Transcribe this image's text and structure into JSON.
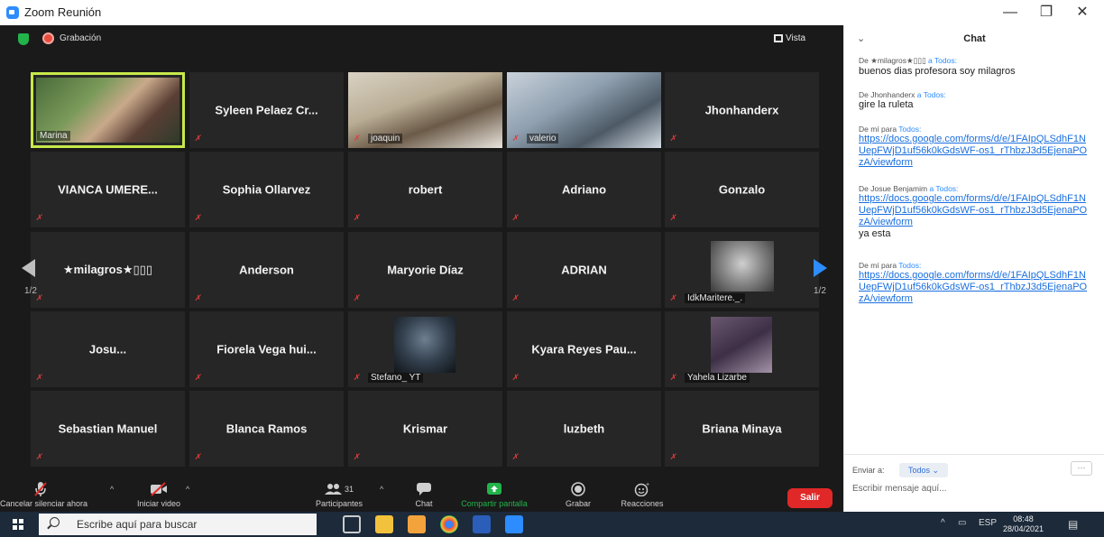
{
  "window": {
    "title": "Zoom Reunión",
    "minimize": "—",
    "restore": "❐",
    "close": "✕"
  },
  "topbar": {
    "recording_label": "Grabación",
    "view_label": "Vista"
  },
  "page_indicator": {
    "left": "1/2",
    "right": "1/2"
  },
  "participants": [
    {
      "name": "Marina",
      "video": true,
      "active": true,
      "muted": false
    },
    {
      "name": "Syleen Pelaez Cr...",
      "video": false,
      "muted": true
    },
    {
      "name": "joaquin",
      "video": true,
      "muted": true
    },
    {
      "name": "valerio",
      "video": true,
      "muted": true
    },
    {
      "name": "Jhonhanderx",
      "video": false,
      "muted": true
    },
    {
      "name": "VIANCA UMERE...",
      "video": false,
      "muted": true
    },
    {
      "name": "Sophia Ollarvez",
      "video": false,
      "muted": true
    },
    {
      "name": "robert",
      "video": false,
      "muted": true
    },
    {
      "name": "Adriano",
      "video": false,
      "muted": true
    },
    {
      "name": "Gonzalo",
      "video": false,
      "muted": true
    },
    {
      "name": "★milagros★▯▯▯",
      "video": false,
      "muted": true
    },
    {
      "name": "Anderson",
      "video": false,
      "muted": true
    },
    {
      "name": "Maryorie Díaz",
      "video": false,
      "muted": true
    },
    {
      "name": "ADRIAN",
      "video": false,
      "muted": true
    },
    {
      "name": "IdkMaritere._.",
      "video": true,
      "muted": true
    },
    {
      "name": "Josu...",
      "video": false,
      "muted": true
    },
    {
      "name": "Fiorela Vega hui...",
      "video": false,
      "muted": true
    },
    {
      "name": "Stefano_ YT",
      "video": true,
      "muted": true
    },
    {
      "name": "Kyara Reyes Pau...",
      "video": false,
      "muted": true
    },
    {
      "name": "Yahela Lizarbe",
      "video": true,
      "muted": true
    },
    {
      "name": "Sebastian Manuel",
      "video": false,
      "muted": true
    },
    {
      "name": "Blanca Ramos",
      "video": false,
      "muted": true
    },
    {
      "name": "Krismar",
      "video": false,
      "muted": true
    },
    {
      "name": "luzbeth",
      "video": false,
      "muted": true
    },
    {
      "name": "Briana Minaya",
      "video": false,
      "muted": true
    }
  ],
  "toolbar": {
    "unmute_label": "Cancelar silenciar ahora",
    "video_label": "Iniciar video",
    "participants_count": "31",
    "participants_label": "Participantes",
    "chat_label": "Chat",
    "share_label": "Compartir pantalla",
    "record_label": "Grabar",
    "reactions_label": "Reacciones",
    "leave_label": "Salir"
  },
  "chat": {
    "title": "Chat",
    "messages": [
      {
        "from": "De ★milagros★▯▯▯",
        "to": "a Todos:",
        "lines": [
          "buenos dias profesora soy milagros"
        ],
        "link": ""
      },
      {
        "from": "De Jhonhanderx",
        "to": "a Todos:",
        "lines": [
          "gire la ruleta"
        ],
        "link": ""
      },
      {
        "from": "De mí para",
        "to": "Todos:",
        "lines": [],
        "link": "https://docs.google.com/forms/d/e/1FAIpQLSdhF1NUepFWjD1uf56k0kGdsWF-os1_rThbzJ3d5EjenaPOzA/viewform"
      },
      {
        "from": "De          Josue Benjamim",
        "to": "a Todos:",
        "lines": [
          "ya  esta"
        ],
        "link": "https://docs.google.com/forms/d/e/1FAIpQLSdhF1NUepFWjD1uf56k0kGdsWF-os1_rThbzJ3d5EjenaPOzA/viewform"
      },
      {
        "from": "De mí para",
        "to": "Todos:",
        "lines": [],
        "link": "https://docs.google.com/forms/d/e/1FAIpQLSdhF1NUepFWjD1uf56k0kGdsWF-os1_rThbzJ3d5EjenaPOzA/viewform"
      }
    ],
    "send_to_label": "Enviar a:",
    "send_to_value": "Todos ⌄",
    "more": "···",
    "input_placeholder": "Escribir mensaje aquí..."
  },
  "taskbar": {
    "search_placeholder": "Escribe aquí para buscar",
    "lang": "ESP",
    "time": "08:48",
    "date": "28/04/2021"
  },
  "colors": {
    "accent": "#2d8cff",
    "leave": "#e02828",
    "speaker_border": "#c7e94a",
    "share": "#22b44b"
  }
}
